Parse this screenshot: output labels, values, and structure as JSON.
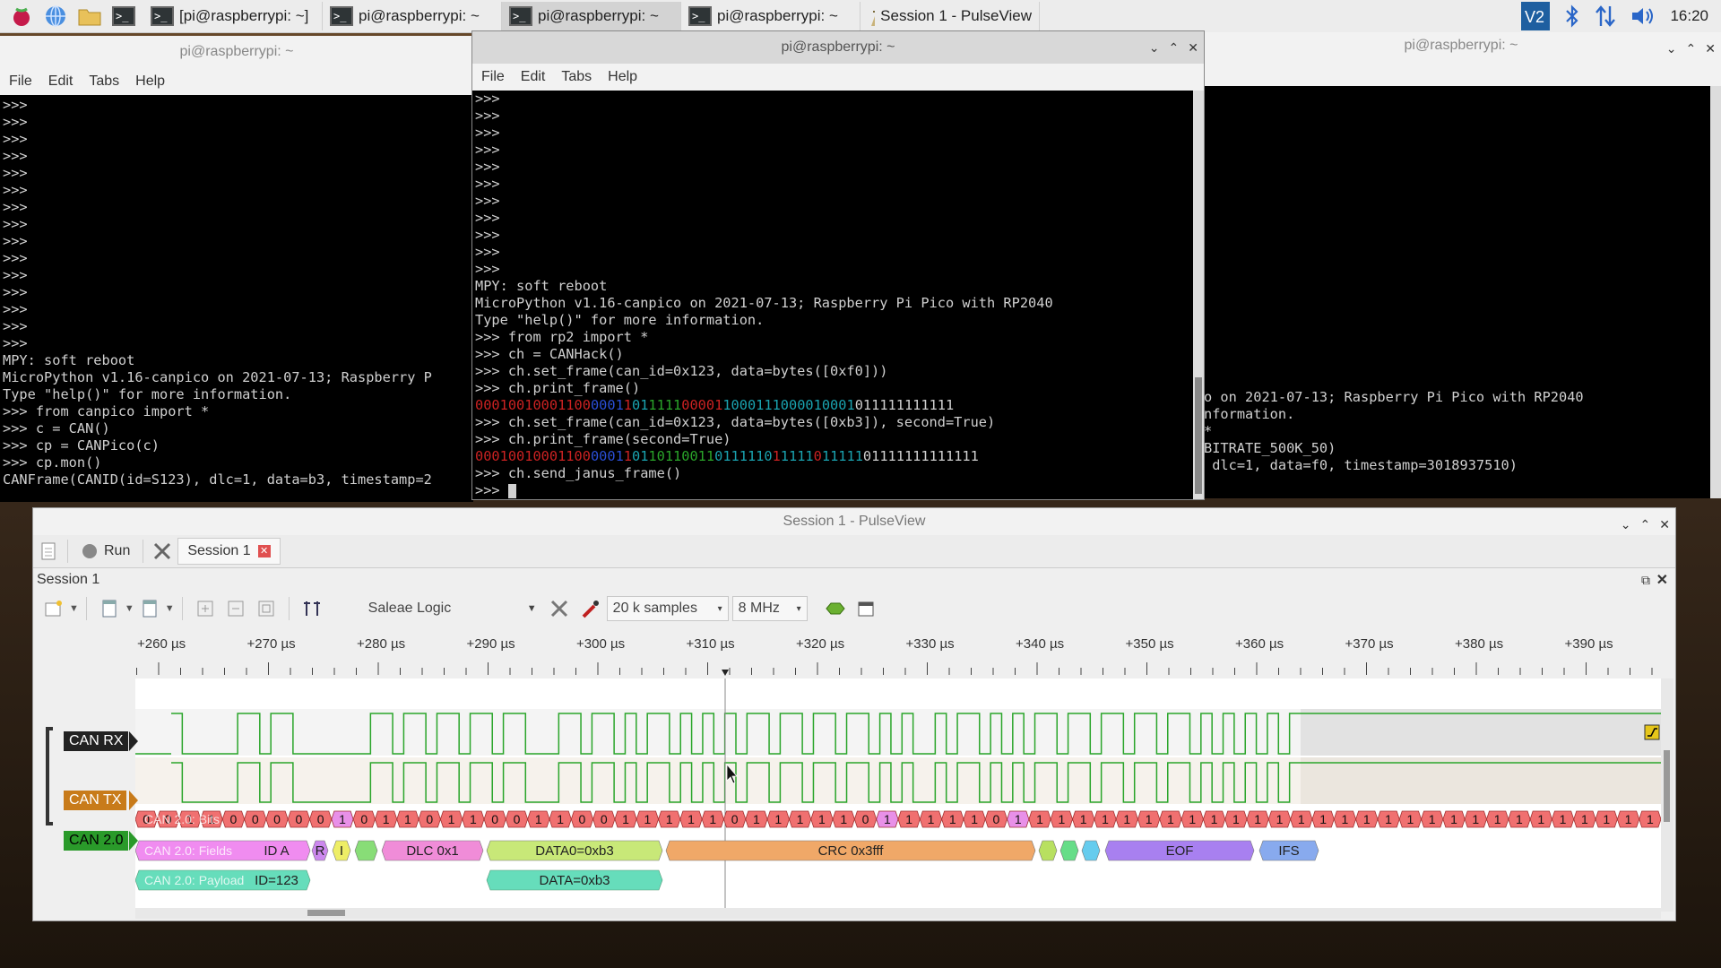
{
  "taskbar": {
    "tasks": [
      {
        "label": "[pi@raspberrypi: ~]",
        "icon": "terminal-icon",
        "active": false
      },
      {
        "label": "pi@raspberrypi: ~",
        "icon": "terminal-icon",
        "active": false
      },
      {
        "label": "pi@raspberrypi: ~",
        "icon": "terminal-icon",
        "active": true
      },
      {
        "label": "pi@raspberrypi: ~",
        "icon": "terminal-icon",
        "active": false
      },
      {
        "label": "Session 1 - PulseView",
        "icon": "pulseview-icon",
        "active": false
      }
    ],
    "clock": "16:20"
  },
  "term_left": {
    "title": "pi@raspberrypi: ~",
    "menu": [
      "File",
      "Edit",
      "Tabs",
      "Help"
    ],
    "lines": [
      ">>>",
      ">>>",
      ">>>",
      ">>>",
      ">>>",
      ">>>",
      ">>>",
      ">>>",
      ">>>",
      ">>>",
      ">>>",
      ">>>",
      ">>>",
      ">>>",
      ">>>",
      "MPY: soft reboot",
      "MicroPython v1.16-canpico on 2021-07-13; Raspberry P",
      "Type \"help()\" for more information.",
      ">>> from canpico import *",
      ">>> c = CAN()",
      ">>> cp = CANPico(c)",
      ">>> cp.mon()",
      "CANFrame(CANID(id=S123), dlc=1, data=b3, timestamp=2"
    ]
  },
  "term_mid": {
    "title": "pi@raspberrypi: ~",
    "menu": [
      "File",
      "Edit",
      "Tabs",
      "Help"
    ],
    "lines": [
      ">>>",
      ">>>",
      ">>>",
      ">>>",
      ">>>",
      ">>>",
      ">>>",
      ">>>",
      ">>>",
      ">>>",
      ">>>",
      "MPY: soft reboot",
      "MicroPython v1.16-canpico on 2021-07-13; Raspberry Pi Pico with RP2040",
      "Type \"help()\" for more information.",
      ">>> from rp2 import *",
      ">>> ch = CANHack()",
      ">>> ch.set_frame(can_id=0x123, data=bytes([0xf0]))",
      ">>> ch.print_frame()"
    ],
    "bits1": [
      [
        "r",
        "00010010001100"
      ],
      [
        "b",
        "0001"
      ],
      [
        "r",
        "1"
      ],
      [
        "c",
        "01"
      ],
      [
        "g",
        "1111"
      ],
      [
        "r",
        "00001"
      ],
      [
        "c",
        "1000111000010001"
      ],
      [
        "w",
        "011111111111"
      ]
    ],
    "lines2": [
      ">>> ch.set_frame(can_id=0x123, data=bytes([0xb3]), second=True)",
      ">>> ch.print_frame(second=True)"
    ],
    "bits2": [
      [
        "r",
        "00010010001100"
      ],
      [
        "b",
        "0001"
      ],
      [
        "r",
        "1"
      ],
      [
        "c",
        "01"
      ],
      [
        "g",
        "10110011"
      ],
      [
        "c",
        "0111110"
      ],
      [
        "r",
        "1"
      ],
      [
        "c",
        "1111"
      ],
      [
        "r",
        "0"
      ],
      [
        "c",
        "11111"
      ],
      [
        "w",
        "01111111111111"
      ]
    ],
    "lines3": [
      ">>> ch.send_janus_frame()",
      ">>> "
    ]
  },
  "term_right": {
    "title": "pi@raspberrypi: ~",
    "lines": [
      "o on 2021-07-13; Raspberry Pi Pico with RP2040",
      "nformation.",
      "*",
      "BITRATE_500K_50)",
      "",
      "",
      " dlc=1, data=f0, timestamp=3018937510)"
    ]
  },
  "pulseview": {
    "title": "Session 1 - PulseView",
    "run_label": "Run",
    "tab_label": "Session 1",
    "session_label": "Session 1",
    "device": "Saleae Logic",
    "samples": "20 k samples",
    "rate": "8 MHz",
    "ruler_ticks": [
      "+260 µs",
      "+270 µs",
      "+280 µs",
      "+290 µs",
      "+300 µs",
      "+310 µs",
      "+320 µs",
      "+330 µs",
      "+340 µs",
      "+350 µs",
      "+360 µs",
      "+370 µs",
      "+380 µs",
      "+390 µs"
    ],
    "channels": [
      "CAN RX",
      "CAN TX"
    ],
    "decoder": "CAN 2.0",
    "rows": [
      "CAN 2.0: Bits",
      "CAN 2.0: Fields",
      "CAN 2.0: Payload"
    ],
    "bits": [
      "0",
      "0",
      "1",
      "1",
      "0",
      "0",
      "0",
      "0",
      "0",
      "1",
      "0",
      "1",
      "1",
      "0",
      "1",
      "1",
      "0",
      "0",
      "1",
      "1",
      "0",
      "0",
      "1",
      "1",
      "1",
      "1",
      "1",
      "0",
      "1",
      "1",
      "1",
      "1",
      "1",
      "0",
      "1",
      "1",
      "1",
      "1",
      "1",
      "0",
      "1",
      "1",
      "1",
      "1",
      "1",
      "1",
      "1",
      "1",
      "1",
      "1",
      "1",
      "1",
      "1",
      "1",
      "1",
      "1",
      "1",
      "1",
      "1",
      "1",
      "1",
      "1",
      "1",
      "1",
      "1",
      "1",
      "1",
      "1",
      "1",
      "1"
    ],
    "fields": [
      {
        "label": "ID A",
        "color": "#f08cf0"
      },
      {
        "label": "R",
        "color": "#cc88ee"
      },
      {
        "label": "I",
        "color": "#eeee66"
      },
      {
        "label": "",
        "color": "#88dd77"
      },
      {
        "label": "DLC 0x1",
        "color": "#f08cd8"
      },
      {
        "label": "DATA0=0xb3",
        "color": "#c8e878"
      },
      {
        "label": "CRC 0x3fff",
        "color": "#f0a868"
      },
      {
        "label": "",
        "color": "#b8e060"
      },
      {
        "label": "",
        "color": "#66dd88"
      },
      {
        "label": "",
        "color": "#66ccee"
      },
      {
        "label": "EOF",
        "color": "#a880f0"
      },
      {
        "label": "IFS",
        "color": "#88aaee"
      }
    ],
    "payload": [
      {
        "label": "ID=123",
        "color": "#66ddbb"
      },
      {
        "label": "DATA=0xb3",
        "color": "#66ddbb"
      }
    ]
  }
}
